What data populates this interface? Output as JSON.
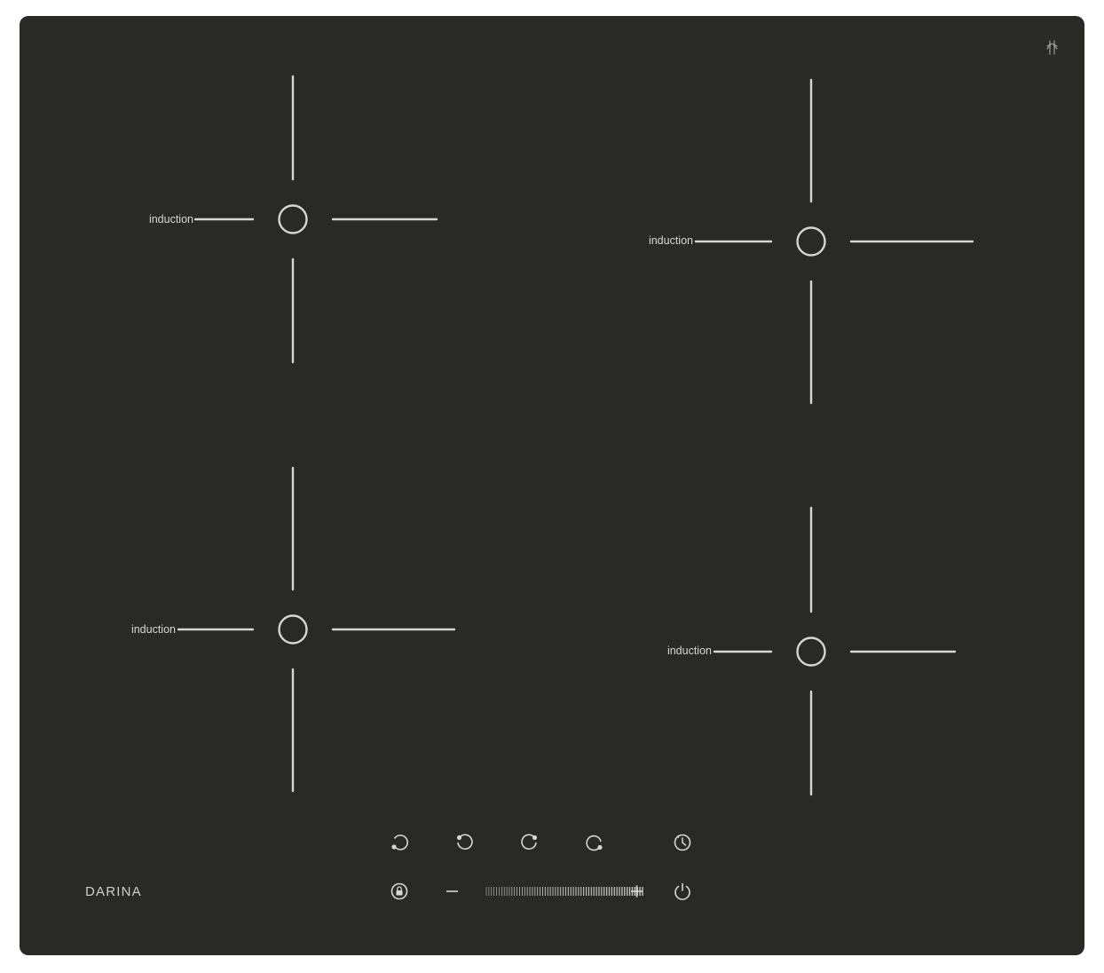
{
  "brand": {
    "name": "DARINA"
  },
  "zones": [
    {
      "label": "induction"
    },
    {
      "label": "induction"
    },
    {
      "label": "induction"
    },
    {
      "label": "induction"
    }
  ],
  "controls": {
    "zone_buttons": [
      {
        "icon": "zone-rear-left-icon"
      },
      {
        "icon": "zone-front-left-icon"
      },
      {
        "icon": "zone-rear-right-icon"
      },
      {
        "icon": "zone-front-right-icon"
      }
    ],
    "timer": {
      "icon": "timer-icon"
    },
    "lock": {
      "icon": "lock-icon"
    },
    "minus": {
      "icon": "minus-icon"
    },
    "plus": {
      "icon": "plus-icon"
    },
    "power": {
      "icon": "power-icon"
    },
    "slider": {
      "icon": "power-slider"
    }
  },
  "colors": {
    "surface": "#292926",
    "marking": "#d6d6d2"
  }
}
